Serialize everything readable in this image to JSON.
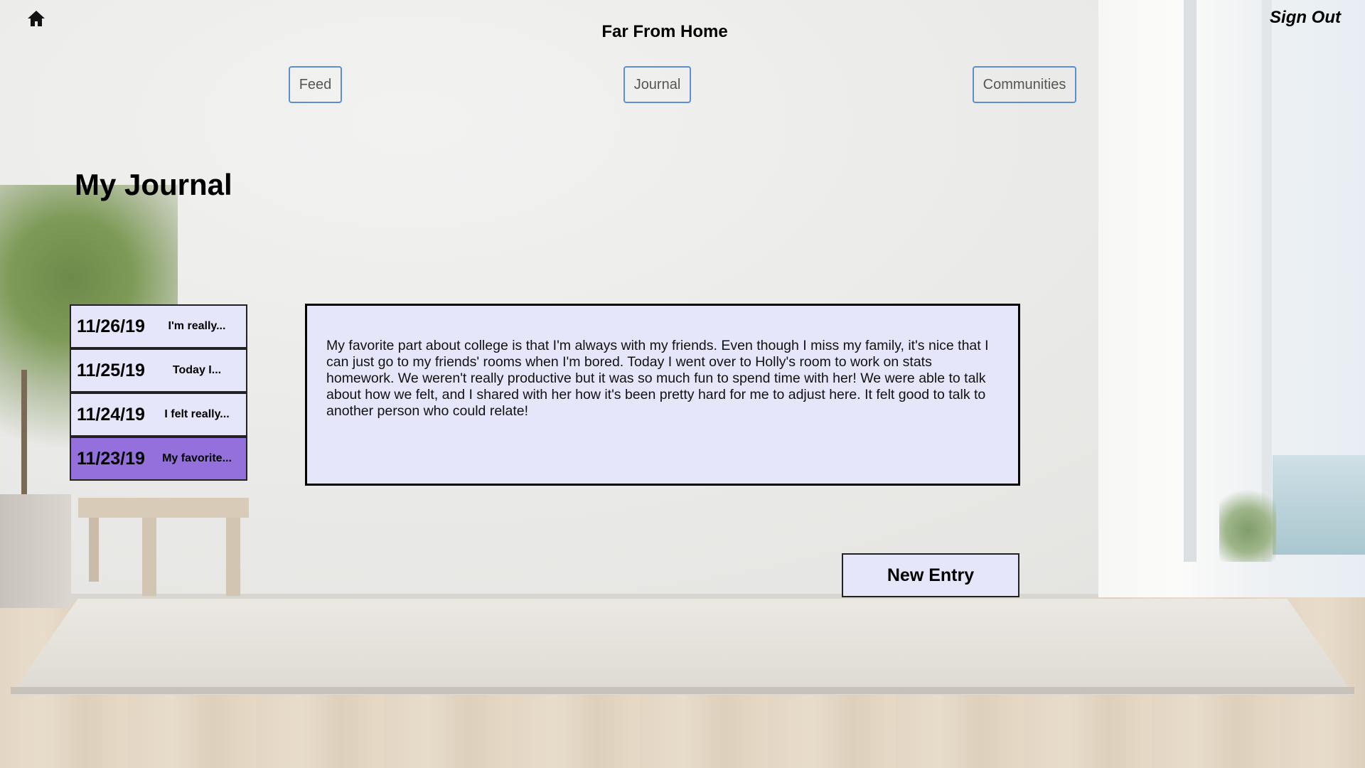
{
  "header": {
    "home_icon": "home-icon",
    "app_title": "Far From Home",
    "sign_out_label": "Sign Out"
  },
  "nav": {
    "feed_label": "Feed",
    "journal_label": "Journal",
    "communities_label": "Communities",
    "accent_color": "#5b8fd0"
  },
  "journal": {
    "title": "My Journal",
    "entries": [
      {
        "date": "11/26/19",
        "preview": "I'm really..."
      },
      {
        "date": "11/25/19",
        "preview": "Today I..."
      },
      {
        "date": "11/24/19",
        "preview": "I felt really..."
      },
      {
        "date": "11/23/19",
        "preview": "My favorite...",
        "active": true
      }
    ],
    "selected_text": "My favorite part about college is that I'm always with my friends. Even though I miss my family, it's nice that I can just go to my friends' rooms when I'm bored. Today I went over to Holly's room to work on stats homework. We weren't really productive but it was so much fun to spend time with her! We were able to talk about how we felt, and I shared with her how it's been pretty hard for me to adjust here. It felt good to talk to another person who could relate!",
    "new_entry_label": "New Entry",
    "colors": {
      "entry_background": "#e6e6fa",
      "active_entry_background": "#9370db"
    }
  }
}
